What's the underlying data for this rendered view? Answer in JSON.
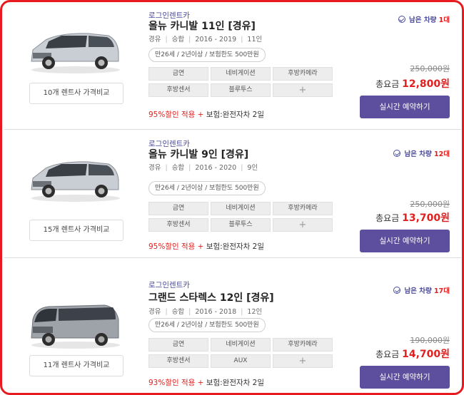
{
  "cards": [
    {
      "company": "로그인렌트카",
      "model": "올뉴 카니발 11인 [경유]",
      "meta": [
        "경유",
        "승합",
        "2016 - 2019",
        "11인"
      ],
      "condition": "만26세 / 2년이상 / 보험한도 500만원",
      "options": [
        "금연",
        "네비게이션",
        "후방카메라",
        "후방센서",
        "블루투스",
        "+"
      ],
      "discount": "95%할인 적용",
      "plus": "+",
      "insurance": "보험:완전자차 2일",
      "available_label": "남은 차량",
      "available_count": "1대",
      "original_price": "250,000원",
      "total_label": "총요금",
      "total_price": "12,800원",
      "reserve_label": "실시간 예약하기",
      "compare_label": "10개 렌트사 가격비교",
      "car_color": "#c9ced4"
    },
    {
      "company": "로그인렌트카",
      "model": "올뉴 카니발 9인 [경유]",
      "meta": [
        "경유",
        "승합",
        "2016 - 2020",
        "9인"
      ],
      "condition": "만26세 / 2년이상 / 보험한도 500만원",
      "options": [
        "금연",
        "네비게이션",
        "후방카메라",
        "후방센서",
        "블루투스",
        "+"
      ],
      "discount": "95%할인 적용",
      "plus": "+",
      "insurance": "보험:완전자차 2일",
      "available_label": "남은 차량",
      "available_count": "12대",
      "original_price": "250,000원",
      "total_label": "총요금",
      "total_price": "13,700원",
      "reserve_label": "실시간 예약하기",
      "compare_label": "15개 렌트사 가격비교",
      "car_color": "#c9ced4"
    },
    {
      "company": "로그인렌트카",
      "model": "그랜드 스타렉스 12인 [경유]",
      "meta": [
        "경유",
        "승합",
        "2016 - 2018",
        "12인"
      ],
      "condition": "만26세 / 2년이상 / 보험한도 500만원",
      "options": [
        "금연",
        "네비게이션",
        "후방카메라",
        "후방센서",
        "AUX",
        "+"
      ],
      "discount": "93%할인 적용",
      "plus": "+",
      "insurance": "보험:완전자차 2일",
      "available_label": "남은 차량",
      "available_count": "17대",
      "original_price": "190,000원",
      "total_label": "총요금",
      "total_price": "14,700원",
      "reserve_label": "실시간 예약하기",
      "compare_label": "11개 렌트사 가격비교",
      "car_color": "#9ea3aa"
    }
  ],
  "colors": {
    "accent": "#5d4f9e",
    "price": "#e02020",
    "frame": "#e8191f"
  }
}
